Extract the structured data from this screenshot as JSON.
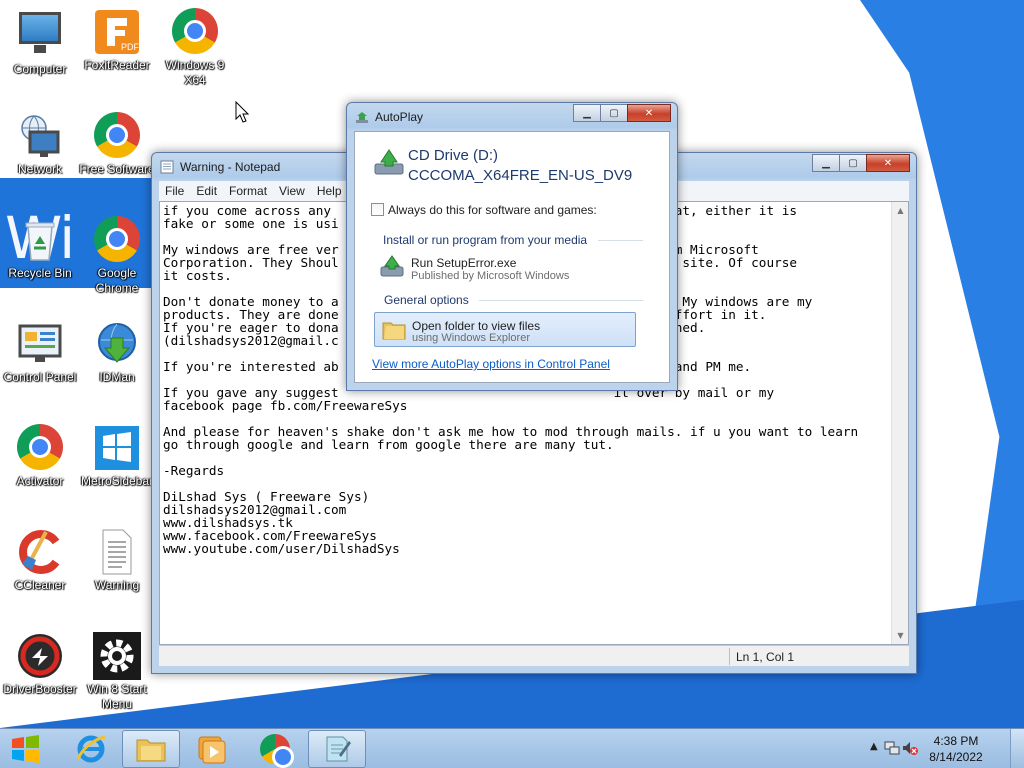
{
  "desktop": {
    "icons": [
      {
        "label": "Computer",
        "icon": "computer-icon"
      },
      {
        "label": "FoxitReader",
        "icon": "foxit-reader-icon"
      },
      {
        "label": "Windows 9 X64",
        "icon": "chrome-icon"
      },
      {
        "label": "Network",
        "icon": "network-icon"
      },
      {
        "label": "Free Software",
        "icon": "chrome-icon"
      },
      {
        "label": "Recycle Bin",
        "icon": "recycle-bin-icon"
      },
      {
        "label": "Google Chrome",
        "icon": "chrome-icon"
      },
      {
        "label": "Control Panel",
        "icon": "control-panel-icon"
      },
      {
        "label": "IDMan",
        "icon": "idm-icon"
      },
      {
        "label": "Activator",
        "icon": "chrome-icon"
      },
      {
        "label": "MetroSidebar",
        "icon": "metro-sidebar-icon"
      },
      {
        "label": "CCleaner",
        "icon": "ccleaner-icon"
      },
      {
        "label": "Warning",
        "icon": "text-file-icon"
      },
      {
        "label": "DriverBooster",
        "icon": "driver-booster-icon"
      },
      {
        "label": "Win 8 Start Menu",
        "icon": "gear-icon"
      }
    ],
    "wallpaper_text": "Wi"
  },
  "notepad": {
    "title": "Warning - Notepad",
    "menu": [
      "File",
      "Edit",
      "Format",
      "View",
      "Help"
    ],
    "lines": [
      "if you come across any                                     ember that, either it is",
      "fake or some one is usi                                    ys.",
      "",
      "My windows are free ver                                    Copy from Microsoft",
      "Corporation. They Shoul                                    icrosoft site. Of course",
      "it costs.",
      "",
      "Don't donate money to a                                    e my OS. My windows are my",
      "products. They are done                                    me and effort in it.",
      "If you're eager to dona                                    v mentioned.",
      "(dilshadsys2012@gmail.c",
      "",
      "If you're interested ab                                    t at it and PM me.",
      "",
      "If you gave any suggest                                    it over by mail or my",
      "facebook page fb.com/FreewareSys",
      "",
      "And please for heaven's shake don't ask me how to mod through mails. if u you want to learn",
      "go through google and learn from google there are many tut.",
      "",
      "-Regards",
      "",
      "DiLshad Sys ( Freeware Sys)",
      "dilshadsys2012@gmail.com",
      "www.dilshadsys.tk",
      "www.facebook.com/FreewareSys",
      "www.youtube.com/user/DilshadSys"
    ],
    "status": "Ln 1, Col 1"
  },
  "autoplay": {
    "title": "AutoPlay",
    "drive_name": "CD Drive (D:)",
    "drive_label": "CCCOMA_X64FRE_EN-US_DV9",
    "always_label": "Always do this for software and games:",
    "always_checked": false,
    "install_group": "Install or run program from your media",
    "run_title": "Run SetupError.exe",
    "run_sub": "Published by Microsoft Windows",
    "general_group": "General options",
    "open_title": "Open folder to view files",
    "open_sub": "using Windows Explorer",
    "more_link": "View more AutoPlay options in Control Panel"
  },
  "taskbar": {
    "items": [
      {
        "icon": "internet-explorer-icon",
        "active": false
      },
      {
        "icon": "file-explorer-icon",
        "active": true
      },
      {
        "icon": "media-player-icon",
        "active": false
      },
      {
        "icon": "chrome-icon",
        "active": false
      },
      {
        "icon": "notepad-icon",
        "active": true
      }
    ],
    "clock_time": "4:38 PM",
    "clock_date": "8/14/2022"
  },
  "colors": {
    "link": "#0b5cc7",
    "heading": "#1e3a6e",
    "close_button": "#c7412a",
    "wallpaper_blue": "#1e74d8"
  }
}
